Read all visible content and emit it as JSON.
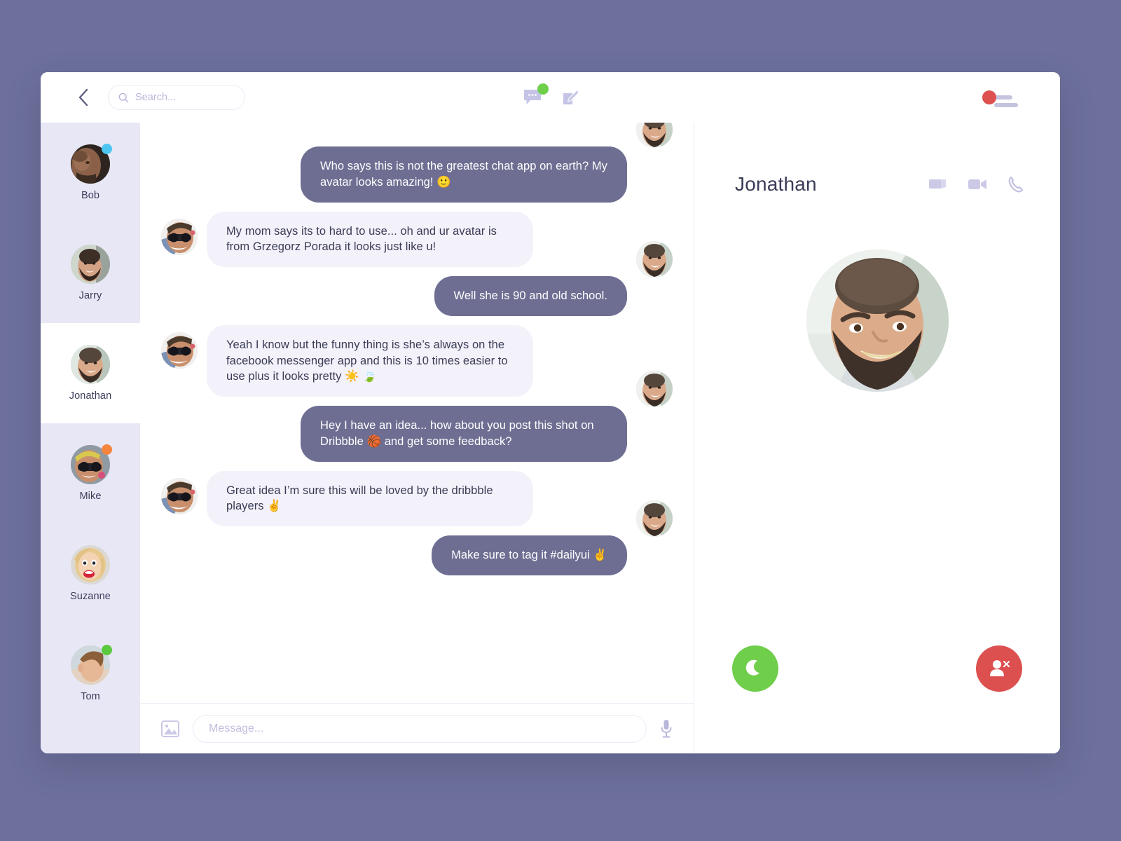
{
  "header": {
    "back_icon": "chevron-left-icon",
    "search_placeholder": "Search...",
    "search_value": "",
    "search_icon": "search-icon",
    "messages_icon": "chat-bubble-icon",
    "messages_badge_color": "#6fce4a",
    "compose_icon": "compose-edit-icon",
    "account_icon": "user-menu-icon",
    "account_dot_color": "#dd5050"
  },
  "sidebar": {
    "contacts": [
      {
        "name": "Bob",
        "status_color": "#4cc6f0",
        "has_status": true,
        "active": false,
        "avatar": "bob-avatar"
      },
      {
        "name": "Jarry",
        "status_color": "",
        "has_status": false,
        "active": false,
        "avatar": "jarry-avatar"
      },
      {
        "name": "Jonathan",
        "status_color": "",
        "has_status": false,
        "active": true,
        "avatar": "jonathan-avatar"
      },
      {
        "name": "Mike",
        "status_color": "#f5843f",
        "has_status": true,
        "active": false,
        "avatar": "mike-avatar"
      },
      {
        "name": "Suzanne",
        "status_color": "",
        "has_status": false,
        "active": false,
        "avatar": "suzanne-avatar"
      },
      {
        "name": "Tom",
        "status_color": "#5bc940",
        "has_status": true,
        "active": false,
        "avatar": "tom-avatar"
      }
    ]
  },
  "chat": {
    "messages": [
      {
        "side": "out",
        "text": "Who says this is not the greatest chat app on earth? My avatar looks amazing! 🙂",
        "avatar": "jonathan-avatar"
      },
      {
        "side": "in",
        "text": "My mom says its to hard to use... oh and ur avatar is from Grzegorz Porada it looks just like u!",
        "avatar": "glasses-man-avatar"
      },
      {
        "side": "out",
        "text": "Well she is 90 and old school.",
        "avatar": "jonathan-avatar"
      },
      {
        "side": "in",
        "text": "Yeah I know but the funny thing is she’s always on the facebook messenger app and this is 10 times easier to use plus it looks pretty ☀️ 🍃",
        "avatar": "glasses-man-avatar"
      },
      {
        "side": "out",
        "text": "Hey I have an idea... how about you post this shot on Dribbble 🏀 and get some feedback?",
        "avatar": "jonathan-avatar"
      },
      {
        "side": "in",
        "text": "Great idea I’m sure this will be loved by the dribbble players ✌️",
        "avatar": "glasses-man-avatar"
      },
      {
        "side": "out",
        "text": "Make sure to tag it #dailyui ✌️",
        "avatar": "jonathan-avatar"
      }
    ],
    "composer": {
      "image_icon": "image-attach-icon",
      "placeholder": "Message...",
      "value": "",
      "mic_icon": "microphone-icon"
    }
  },
  "profile": {
    "name": "Jonathan",
    "actions": [
      {
        "icon": "screen-share-icon",
        "label": "Screen share"
      },
      {
        "icon": "video-camera-icon",
        "label": "Video call"
      },
      {
        "icon": "phone-icon",
        "label": "Voice call"
      }
    ],
    "photo": "jonathan-large-photo",
    "mute_button": {
      "icon": "moon-icon",
      "color": "#6fce4a",
      "label": "Mute"
    },
    "block_button": {
      "icon": "user-remove-icon",
      "color": "#dd5050",
      "label": "Block"
    }
  },
  "theme": {
    "page_background": "#6c709b",
    "sidebar_background": "#e8e7f5",
    "bubble_out": "#6e6e93",
    "bubble_in": "#f3f2fa",
    "text_dark": "#3a3b56"
  }
}
